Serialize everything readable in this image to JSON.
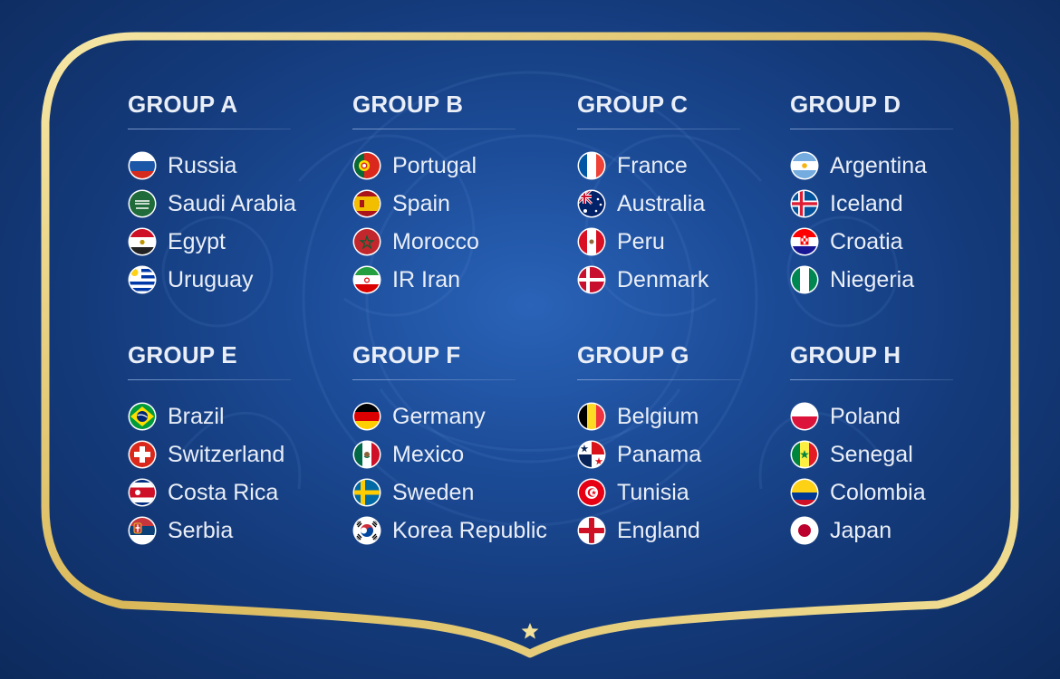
{
  "accent_gold": "#e8d28a",
  "groups": [
    {
      "title": "GROUP A",
      "teams": [
        {
          "name": "Russia",
          "flag": "russia-flag-icon"
        },
        {
          "name": "Saudi Arabia",
          "flag": "saudi-arabia-flag-icon"
        },
        {
          "name": "Egypt",
          "flag": "egypt-flag-icon"
        },
        {
          "name": "Uruguay",
          "flag": "uruguay-flag-icon"
        }
      ]
    },
    {
      "title": "GROUP B",
      "teams": [
        {
          "name": "Portugal",
          "flag": "portugal-flag-icon"
        },
        {
          "name": "Spain",
          "flag": "spain-flag-icon"
        },
        {
          "name": "Morocco",
          "flag": "morocco-flag-icon"
        },
        {
          "name": "IR Iran",
          "flag": "iran-flag-icon"
        }
      ]
    },
    {
      "title": "GROUP C",
      "teams": [
        {
          "name": "France",
          "flag": "france-flag-icon"
        },
        {
          "name": "Australia",
          "flag": "australia-flag-icon"
        },
        {
          "name": "Peru",
          "flag": "peru-flag-icon"
        },
        {
          "name": "Denmark",
          "flag": "denmark-flag-icon"
        }
      ]
    },
    {
      "title": "GROUP D",
      "teams": [
        {
          "name": "Argentina",
          "flag": "argentina-flag-icon"
        },
        {
          "name": "Iceland",
          "flag": "iceland-flag-icon"
        },
        {
          "name": "Croatia",
          "flag": "croatia-flag-icon"
        },
        {
          "name": "Niegeria",
          "flag": "nigeria-flag-icon"
        }
      ]
    },
    {
      "title": "GROUP E",
      "teams": [
        {
          "name": "Brazil",
          "flag": "brazil-flag-icon"
        },
        {
          "name": "Switzerland",
          "flag": "switzerland-flag-icon"
        },
        {
          "name": "Costa Rica",
          "flag": "costa-rica-flag-icon"
        },
        {
          "name": "Serbia",
          "flag": "serbia-flag-icon"
        }
      ]
    },
    {
      "title": "GROUP F",
      "teams": [
        {
          "name": "Germany",
          "flag": "germany-flag-icon"
        },
        {
          "name": "Mexico",
          "flag": "mexico-flag-icon"
        },
        {
          "name": "Sweden",
          "flag": "sweden-flag-icon"
        },
        {
          "name": "Korea Republic",
          "flag": "korea-republic-flag-icon"
        }
      ]
    },
    {
      "title": "GROUP G",
      "teams": [
        {
          "name": "Belgium",
          "flag": "belgium-flag-icon"
        },
        {
          "name": "Panama",
          "flag": "panama-flag-icon"
        },
        {
          "name": "Tunisia",
          "flag": "tunisia-flag-icon"
        },
        {
          "name": "England",
          "flag": "england-flag-icon"
        }
      ]
    },
    {
      "title": "GROUP H",
      "teams": [
        {
          "name": "Poland",
          "flag": "poland-flag-icon"
        },
        {
          "name": "Senegal",
          "flag": "senegal-flag-icon"
        },
        {
          "name": "Colombia",
          "flag": "colombia-flag-icon"
        },
        {
          "name": "Japan",
          "flag": "japan-flag-icon"
        }
      ]
    }
  ]
}
